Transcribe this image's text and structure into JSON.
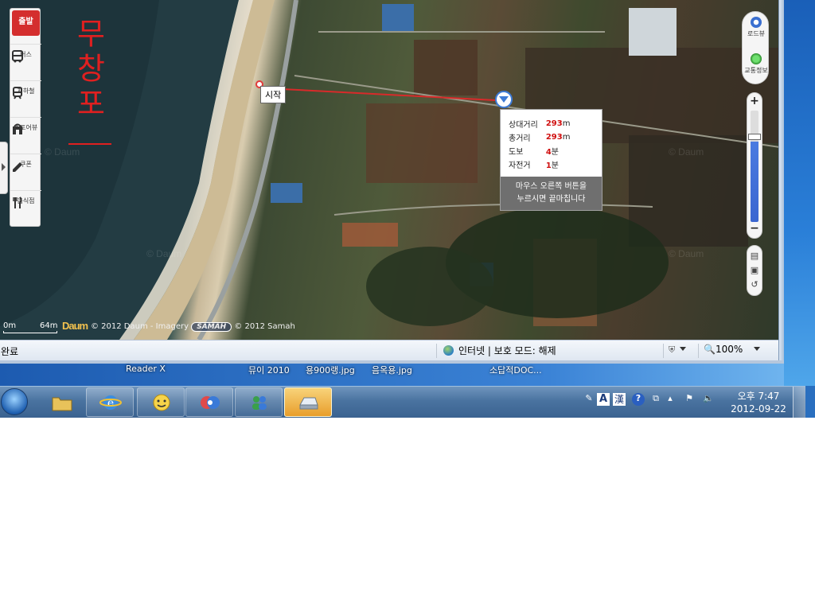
{
  "map": {
    "handwritten_label": "무창포",
    "watermark": "© Daum",
    "start_label": "시작",
    "start_button_label": "출발",
    "toolbar": [
      {
        "label": "버스",
        "icon": "bus-icon"
      },
      {
        "label": "지하철",
        "icon": "subway-icon"
      },
      {
        "label": "스토어뷰",
        "icon": "store-icon"
      },
      {
        "label": "쿠폰",
        "icon": "coupon-icon"
      },
      {
        "label": "음식점",
        "icon": "restaurant-icon"
      }
    ],
    "right_controls": {
      "roadview": "로드뷰",
      "traffic": "교통정보"
    },
    "distance_popup": {
      "rows": [
        {
          "label": "상대거리",
          "value": "293",
          "unit": "m"
        },
        {
          "label": "총거리",
          "value": "293",
          "unit": "m"
        },
        {
          "label": "도보",
          "value": "4",
          "unit": "분"
        },
        {
          "label": "자전거",
          "value": "1",
          "unit": "분"
        }
      ],
      "hint_line1": "마우스 오른쪽 버튼을",
      "hint_line2": "누르시면 끝마칩니다"
    },
    "scale": {
      "start": "0m",
      "end": "64m"
    },
    "logo": "Daum",
    "copyright_prefix": "© 2012 Daum - Imagery",
    "samah_badge": "SAMAH",
    "copyright_suffix": "© 2012 Samah"
  },
  "status_bar": {
    "status_text": "완료",
    "zone": "인터넷 | 보호 모드: 해제",
    "zoom": "100%"
  },
  "desktop_labels": [
    "Reader X",
    "뮤이 2010",
    "용900랭.jpg",
    "음옥용.jpg",
    "소답적DOC..."
  ],
  "taskbar": {
    "buttons": [
      {
        "name": "explorer",
        "icon": "folder-icon"
      },
      {
        "name": "internet-explorer",
        "icon": "ie-icon"
      },
      {
        "name": "messenger-1",
        "icon": "smiley-icon"
      },
      {
        "name": "messenger-2",
        "icon": "chat-icon"
      },
      {
        "name": "messenger-3",
        "icon": "people-icon"
      },
      {
        "name": "app-active",
        "icon": "drive-icon"
      }
    ],
    "tray": {
      "ime_a": "A",
      "ime_han": "漢"
    },
    "clock_time": "오후 7:47",
    "clock_date": "2012-09-22"
  }
}
